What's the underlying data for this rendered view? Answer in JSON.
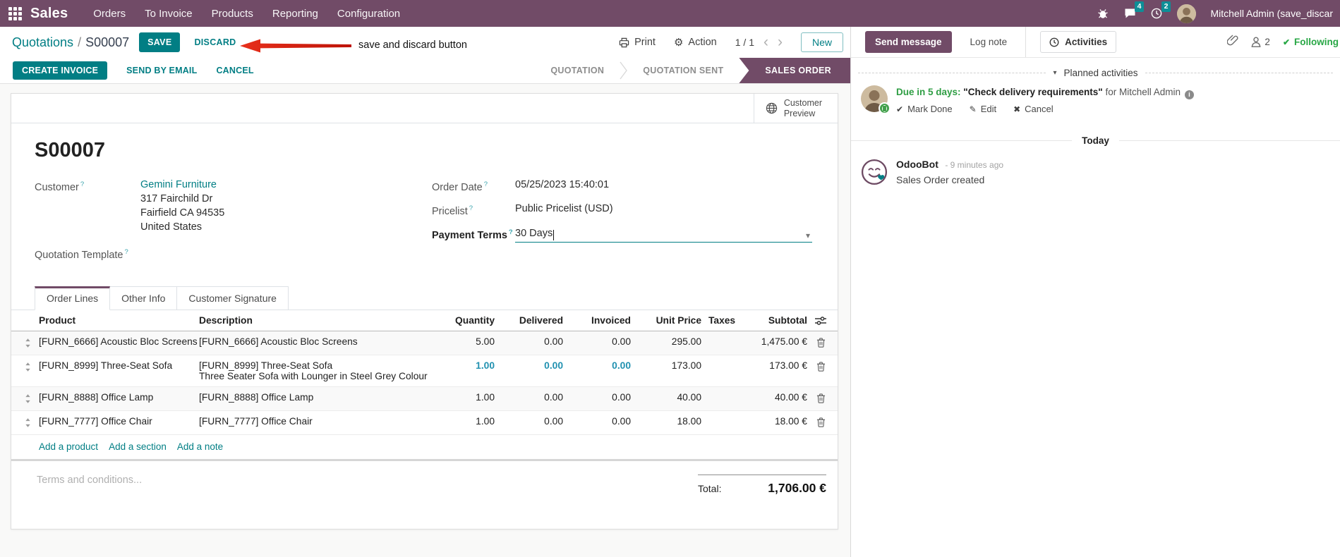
{
  "colors": {
    "brand_purple": "#714B67",
    "primary_teal": "#017E84",
    "badge_teal": "#0E8E97",
    "success_green": "#28a745",
    "arrow_red": "#D92B1A",
    "highlight_blue": "#2191B0"
  },
  "icons": {
    "gear": "⚙",
    "check": "✔",
    "pencil": "✎",
    "cross": "✖",
    "caret_down": "▾",
    "chevron_left": "‹",
    "chevron_right": "›"
  },
  "topbar": {
    "app_name": "Sales",
    "menus": [
      "Orders",
      "To Invoice",
      "Products",
      "Reporting",
      "Configuration"
    ],
    "message_count": "4",
    "activity_count": "2",
    "user_name": "Mitchell Admin (save_discar"
  },
  "annotation": {
    "text": "save and discard button"
  },
  "control_panel": {
    "breadcrumb_parent": "Quotations",
    "breadcrumb_separator": "/",
    "record_name": "S00007",
    "save": "SAVE",
    "discard": "DISCARD",
    "print": "Print",
    "action": "Action",
    "pager": "1 / 1",
    "new": "New"
  },
  "statusbar": {
    "create_invoice": "CREATE INVOICE",
    "send_by_email": "SEND BY EMAIL",
    "cancel": "CANCEL",
    "states": [
      {
        "label": "QUOTATION"
      },
      {
        "label": "QUOTATION SENT"
      },
      {
        "label": "SALES ORDER"
      }
    ]
  },
  "form": {
    "customer_preview": {
      "line1": "Customer",
      "line2": "Preview"
    },
    "title": "S00007",
    "help_marker": "?",
    "customer": {
      "label": "Customer",
      "name": "Gemini Furniture",
      "address": [
        "317 Fairchild Dr",
        "Fairfield CA 94535",
        "United States"
      ]
    },
    "quotation_template_label": "Quotation Template",
    "order_date": {
      "label": "Order Date",
      "value": "05/25/2023 15:40:01"
    },
    "pricelist": {
      "label": "Pricelist",
      "value": "Public Pricelist (USD)"
    },
    "payment_terms": {
      "label": "Payment Terms",
      "value": "30 Days"
    },
    "tabs": [
      "Order Lines",
      "Other Info",
      "Customer Signature"
    ],
    "columns": {
      "product": "Product",
      "description": "Description",
      "quantity": "Quantity",
      "delivered": "Delivered",
      "invoiced": "Invoiced",
      "unit_price": "Unit Price",
      "taxes": "Taxes",
      "subtotal": "Subtotal"
    },
    "rows": [
      {
        "product": "[FURN_6666] Acoustic Bloc Screens",
        "description": "[FURN_6666] Acoustic Bloc Screens",
        "description2": "",
        "quantity": "5.00",
        "delivered": "0.00",
        "invoiced": "0.00",
        "unit_price": "295.00",
        "taxes": "",
        "subtotal": "1,475.00 €"
      },
      {
        "product": "[FURN_8999] Three-Seat Sofa",
        "description": "[FURN_8999] Three-Seat Sofa",
        "description2": "Three Seater Sofa with Lounger in Steel Grey Colour",
        "quantity": "1.00",
        "delivered": "0.00",
        "invoiced": "0.00",
        "unit_price": "173.00",
        "taxes": "",
        "subtotal": "173.00 €"
      },
      {
        "product": "[FURN_8888] Office Lamp",
        "description": "[FURN_8888] Office Lamp",
        "description2": "",
        "quantity": "1.00",
        "delivered": "0.00",
        "invoiced": "0.00",
        "unit_price": "40.00",
        "taxes": "",
        "subtotal": "40.00 €"
      },
      {
        "product": "[FURN_7777] Office Chair",
        "description": "[FURN_7777] Office Chair",
        "description2": "",
        "quantity": "1.00",
        "delivered": "0.00",
        "invoiced": "0.00",
        "unit_price": "18.00",
        "taxes": "",
        "subtotal": "18.00 €"
      }
    ],
    "footer_links": [
      "Add a product",
      "Add a section",
      "Add a note"
    ],
    "terms_placeholder": "Terms and conditions...",
    "total_label": "Total:",
    "total_value": "1,706.00 €"
  },
  "chatter": {
    "send_message": "Send message",
    "log_note": "Log note",
    "activities": "Activities",
    "followers_count": "2",
    "following": "Following",
    "planned_activities": "Planned activities",
    "activity": {
      "due": "Due in 5 days:",
      "summary": "\"Check delivery requirements\"",
      "assignee": "for Mitchell Admin",
      "mark_done": "Mark Done",
      "edit": "Edit",
      "cancel": "Cancel"
    },
    "date_divider": "Today",
    "message": {
      "author": "OdooBot",
      "time": "- 9 minutes ago",
      "body": "Sales Order created"
    }
  }
}
